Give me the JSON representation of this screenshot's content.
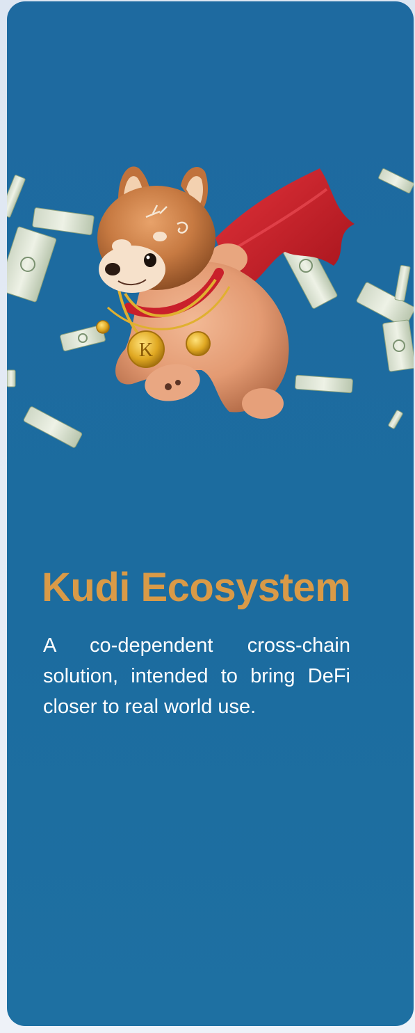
{
  "card": {
    "title": "Kudi Ecosystem",
    "description": "A co-dependent cross-chain solution, intended to bring DeFi closer to real world use."
  },
  "illustration": {
    "icon": "shiba-mascot-with-cape-icon",
    "medallion_letter": "K"
  },
  "colors": {
    "card_background": "#1e6aa0",
    "title": "#d99a47",
    "text": "#ffffff",
    "cape": "#d3202a",
    "gold": "#e0a822"
  }
}
